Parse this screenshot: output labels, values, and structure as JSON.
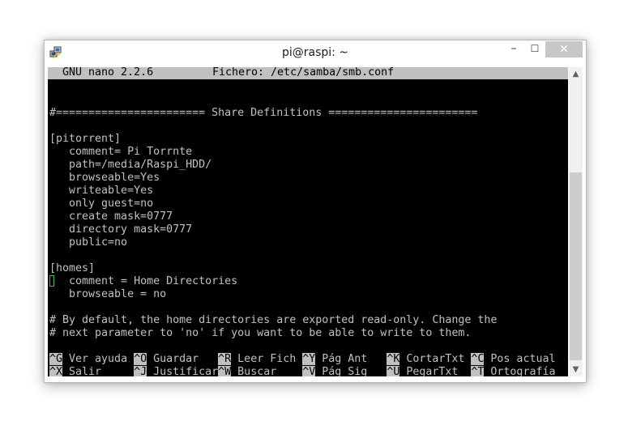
{
  "window": {
    "title": "pi@raspi: ~",
    "icon": "putty-icon",
    "buttons": {
      "minimize": "–",
      "maximize": "☐",
      "close": "✕"
    }
  },
  "nano": {
    "version": "GNU nano 2.2.6",
    "file_label": "Fichero: /etc/samba/smb.conf"
  },
  "editor": {
    "lines": [
      "",
      "",
      "#======================= Share Definitions =======================",
      "",
      "[pitorrent]",
      "   comment= Pi Torrnte",
      "   path=/media/Raspi_HDD/",
      "   browseable=Yes",
      "   writeable=Yes",
      "   only guest=no",
      "   create mask=0777",
      "   directory mask=0777",
      "   public=no",
      "",
      "[homes]",
      "   comment = Home Directories",
      "   browseable = no",
      "",
      "# By default, the home directories are exported read-only. Change the",
      "# next parameter to 'no' if you want to be able to write to them."
    ]
  },
  "shortcuts": {
    "row1": [
      {
        "key": "^G",
        "label": " Ver ayuda "
      },
      {
        "key": "^O",
        "label": " Guardar   "
      },
      {
        "key": "^R",
        "label": " Leer Fich "
      },
      {
        "key": "^Y",
        "label": " Pág Ant   "
      },
      {
        "key": "^K",
        "label": " CortarTxt "
      },
      {
        "key": "^C",
        "label": " Pos actual"
      }
    ],
    "row2": [
      {
        "key": "^X",
        "label": " Salir     "
      },
      {
        "key": "^J",
        "label": " Justificar"
      },
      {
        "key": "^W",
        "label": " Buscar    "
      },
      {
        "key": "^V",
        "label": " Pág Sig   "
      },
      {
        "key": "^U",
        "label": " PegarTxt  "
      },
      {
        "key": "^T",
        "label": " Ortografía"
      }
    ]
  },
  "scrollbar": {
    "up_arrow": "▲",
    "down_arrow": "▼"
  },
  "colors": {
    "terminal_bg": "#000000",
    "terminal_fg": "#c0c0c0",
    "cursor": "#2ec02e"
  }
}
